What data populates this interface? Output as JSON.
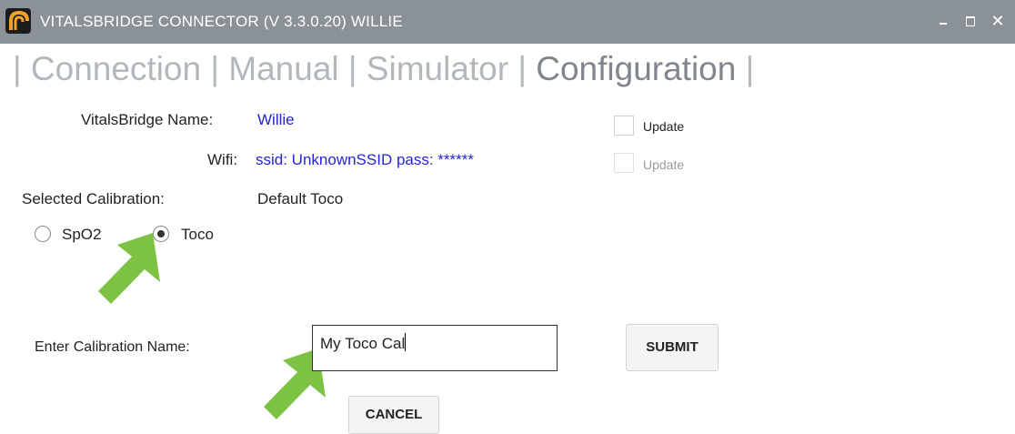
{
  "window": {
    "title": "VITALSBRIDGE CONNECTOR (V 3.3.0.20)  WILLIE",
    "minimize_icon": "minimize-icon",
    "maximize_icon": "maximize-icon",
    "close_label": "✕"
  },
  "tabs": {
    "leading_sep": "| ",
    "items": [
      {
        "label": "Connection",
        "active": false
      },
      {
        "label": "Manual",
        "active": false
      },
      {
        "label": "Simulator",
        "active": false
      },
      {
        "label": "Configuration",
        "active": true
      }
    ],
    "sep": " | "
  },
  "config": {
    "name_label": "VitalsBridge Name:",
    "name_value": "Willie",
    "name_update_label": "Update",
    "wifi_label": "Wifi:",
    "wifi_value": "ssid: UnknownSSID  pass: ******",
    "wifi_update_label": "Update",
    "selected_cal_label": "Selected Calibration:",
    "selected_cal_value": "Default Toco"
  },
  "radios": [
    {
      "label": "SpO2",
      "checked": false
    },
    {
      "label": "Toco",
      "checked": true
    }
  ],
  "calibration_form": {
    "label": "Enter Calibration Name:",
    "input_value": "My Toco Cal",
    "submit_label": "SUBMIT",
    "cancel_label": "CANCEL"
  },
  "colors": {
    "titlebar": "#8a9197",
    "link_value": "#2525d4",
    "arrow": "#7dc242"
  }
}
